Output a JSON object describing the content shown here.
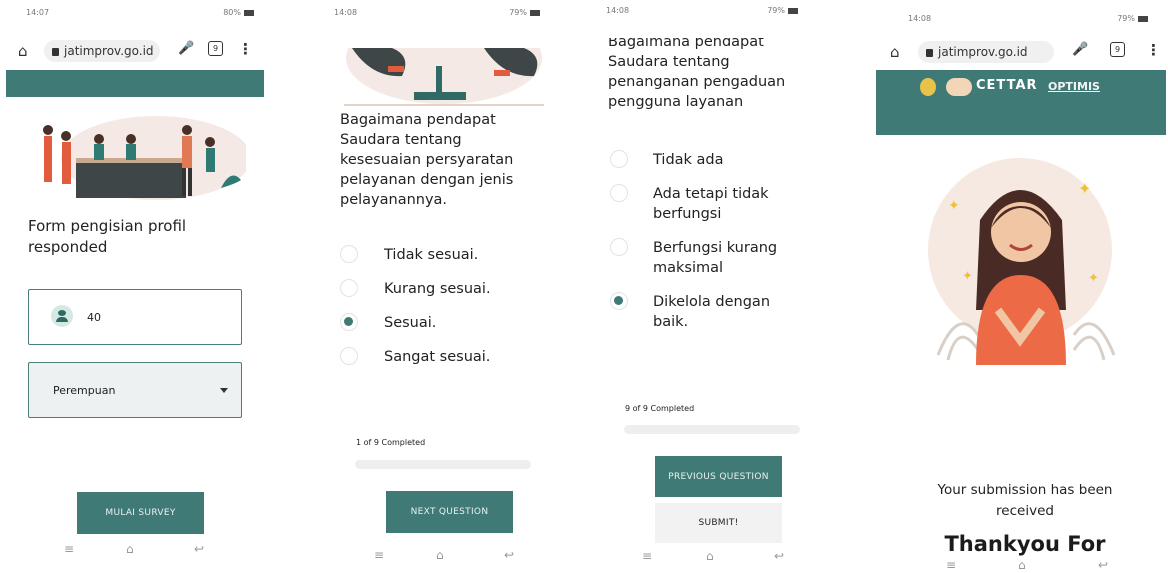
{
  "browser": {
    "url": "jatimprov.go.id",
    "tab_count": "9"
  },
  "screens": [
    {
      "time": "14:07",
      "battery": "80%",
      "form_title": "Form pengisian profil responded",
      "age_value": "40",
      "gender_value": "Perempuan",
      "start_button": "MULAI SURVEY"
    },
    {
      "time": "14:08",
      "battery": "79%",
      "question": "Bagaimana pendapat Saudara tentang kesesuaian persyaratan pelayanan dengan jenis pelayanannya.",
      "options": [
        "Tidak sesuai.",
        "Kurang sesuai.",
        "Sesuai.",
        "Sangat sesuai."
      ],
      "selected_index": 2,
      "progress_label": "1 of 9 Completed",
      "next_button": "NEXT QUESTION"
    },
    {
      "time": "14:08",
      "battery": "79%",
      "question_partial": "Bagaimana pendapat Saudara tentang penanganan pengaduan pengguna layanan",
      "options": [
        "Tidak ada",
        "Ada tetapi tidak berfungsi",
        "Berfungsi kurang maksimal",
        "Dikelola dengan baik."
      ],
      "selected_index": 3,
      "progress_label": "9 of 9 Completed",
      "previous_button": "PREVIOUS QUESTION",
      "submit_button": "SUBMIT!"
    },
    {
      "time": "14:08",
      "battery": "79%",
      "logo_text_1": "CETTAR",
      "logo_text_2": "OPTIMIS",
      "message": "Your submission has been received",
      "headline": "Thankyou For"
    }
  ],
  "colors": {
    "accent": "#3f7a77",
    "progress_track": "#eeeeee"
  },
  "icons": [
    "home-icon",
    "lock-icon",
    "mic-icon",
    "tabs-icon",
    "menu-icon",
    "person-icon",
    "chevron-down-icon",
    "recents-icon",
    "home-nav-icon",
    "back-icon"
  ]
}
